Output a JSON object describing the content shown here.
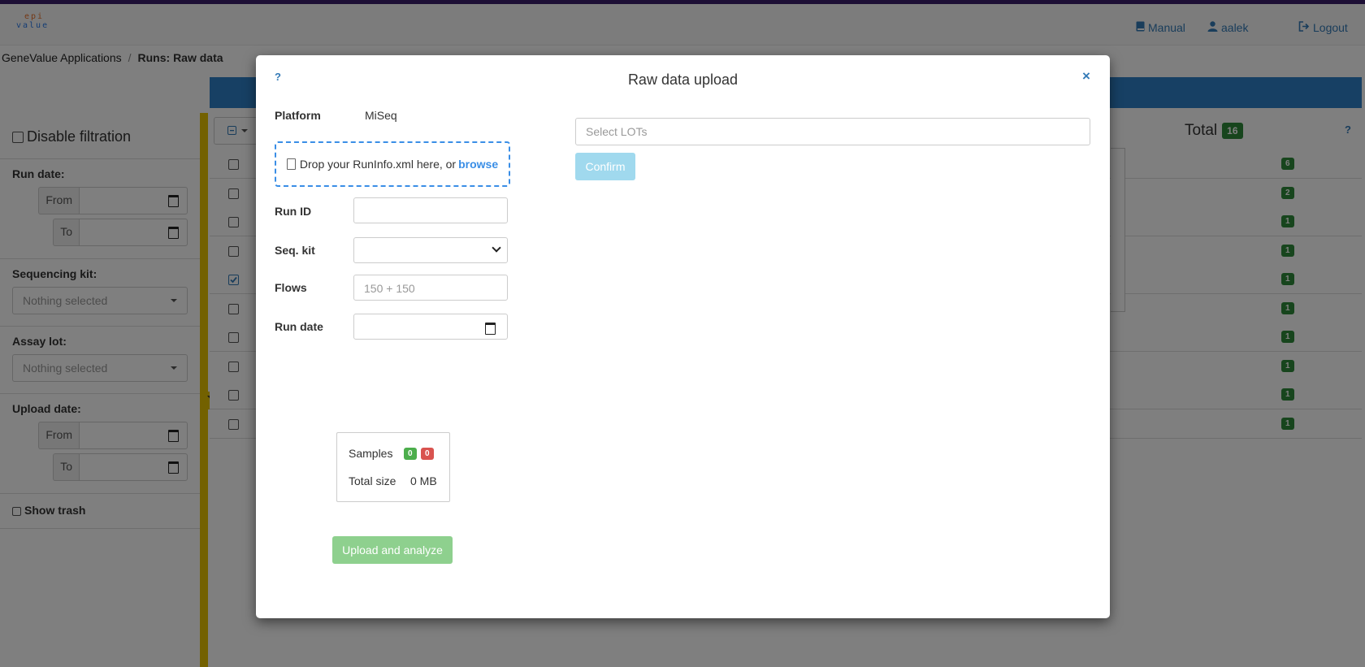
{
  "navbar": {
    "logo": {
      "line1": "epi",
      "line2": "value"
    },
    "manual": "Manual",
    "user": "aalek",
    "logout": "Logout"
  },
  "breadcrumb": {
    "root": "GeneValue Applications",
    "separator": "/",
    "current": "Runs: Raw data"
  },
  "sidebar": {
    "disable_filtration": "Disable filtration",
    "run_date": {
      "label": "Run date:",
      "from": "From",
      "to": "To"
    },
    "sequencing_kit": {
      "label": "Sequencing kit:",
      "placeholder": "Nothing selected"
    },
    "assay_lot": {
      "label": "Assay lot:",
      "placeholder": "Nothing selected"
    },
    "upload_date": {
      "label": "Upload date:",
      "from": "From",
      "to": "To"
    },
    "show_trash": "Show trash"
  },
  "table": {
    "total_label": "Total",
    "total_count": "16",
    "help": "?",
    "rows": [
      {
        "count": "6",
        "checked": false
      },
      {
        "count": "2",
        "checked": false
      },
      {
        "count": "1",
        "checked": false
      },
      {
        "count": "1",
        "checked": false
      },
      {
        "count": "1",
        "checked": true
      },
      {
        "count": "1",
        "checked": false
      },
      {
        "count": "1",
        "checked": false
      },
      {
        "count": "1",
        "checked": false
      },
      {
        "count": "1",
        "checked": false
      },
      {
        "count": "1",
        "checked": false
      }
    ]
  },
  "modal": {
    "help": "?",
    "title": "Raw data upload",
    "close": "×",
    "platform_label": "Platform",
    "platform_value": "MiSeq",
    "dropzone_text": "Drop your RunInfo.xml here, or",
    "dropzone_browse": "browse",
    "run_id_label": "Run ID",
    "run_id_value": "",
    "seq_kit_label": "Seq. kit",
    "seq_kit_value": "",
    "flows_label": "Flows",
    "flows_placeholder": "150 + 150",
    "run_date_label": "Run date",
    "lots_placeholder": "Select LOTs",
    "confirm": "Confirm",
    "samples_label": "Samples",
    "samples_ok": "0",
    "samples_err": "0",
    "total_size_label": "Total size",
    "total_size_value": "0 MB",
    "upload_button": "Upload and analyze"
  },
  "colors": {
    "accent": "#337ab7",
    "filter_bar": "#e6c300",
    "success": "#2e8b3a",
    "danger": "#d9534f",
    "dropzone": "#3a8ee6"
  }
}
